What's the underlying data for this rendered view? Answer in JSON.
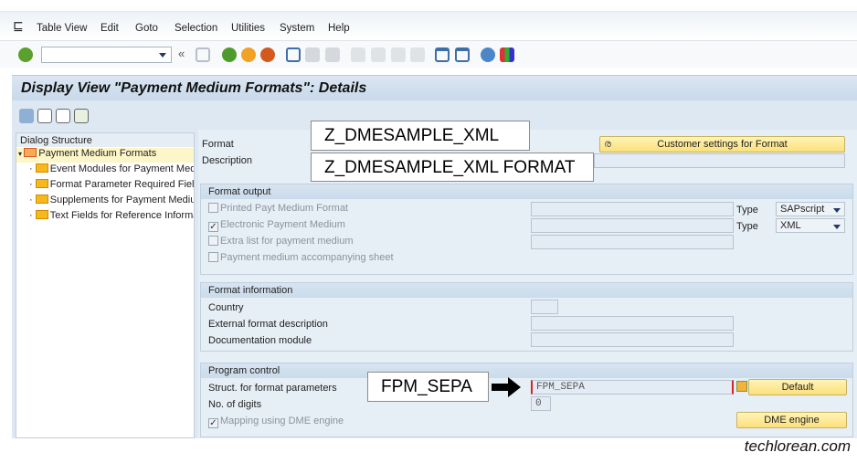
{
  "menu": [
    "Table View",
    "Edit",
    "Goto",
    "Selection",
    "Utilities",
    "System",
    "Help"
  ],
  "title": "Display View \"Payment Medium Formats\": Details",
  "dialog": {
    "header": "Dialog Structure",
    "items": [
      "Payment Medium Formats",
      "Event Modules for Payment Medi",
      "Format Parameter Required Fields",
      "Supplements for Payment Mediur",
      "Text Fields for Reference Informa"
    ]
  },
  "header": {
    "format_label": "Format",
    "description_label": "Description",
    "customer_settings_button": "Customer settings for Format"
  },
  "callouts": {
    "format": "Z_DMESAMPLE_XML",
    "description": "Z_DMESAMPLE_XML FORMAT",
    "struct": "FPM_SEPA"
  },
  "format_output": {
    "title": "Format output",
    "printed": "Printed Payt Medium Format",
    "electronic": "Electronic Payment Medium",
    "extra": "Extra list for payment medium",
    "accompanying": "Payment medium accompanying sheet",
    "type_label": "Type",
    "type1": "SAPscript",
    "type2": "XML"
  },
  "format_info": {
    "title": "Format information",
    "country": "Country",
    "external": "External format description",
    "documentation": "Documentation module"
  },
  "program_control": {
    "title": "Program control",
    "struct_label": "Struct. for format parameters",
    "struct_value": "FPM_SEPA",
    "digits_label": "No. of digits",
    "digits_value": "0",
    "mapping": "Mapping using DME engine",
    "default_button": "Default",
    "dme_button": "DME engine"
  },
  "watermark": "techlorean.com"
}
